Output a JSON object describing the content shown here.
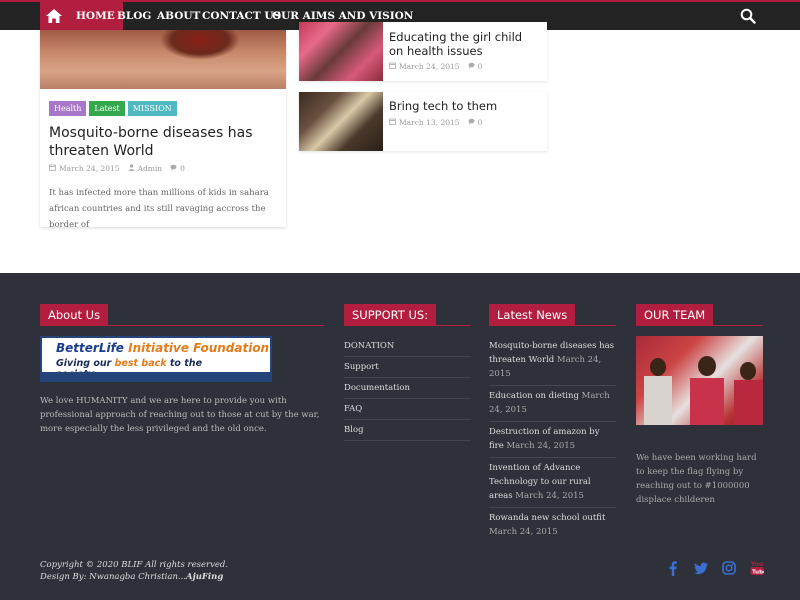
{
  "nav": {
    "items": [
      {
        "label": "HOME",
        "active": true
      },
      {
        "label": "BLOG"
      },
      {
        "label": "ABOUT"
      },
      {
        "label": "CONTACT US"
      },
      {
        "label": "OUR AIMS AND VISION"
      }
    ],
    "home_icon": "home-icon",
    "search_icon": "search-icon"
  },
  "featured": {
    "tags": [
      {
        "label": "Health",
        "color": "#a877c8"
      },
      {
        "label": "Latest",
        "color": "#35a84d"
      },
      {
        "label": "MISSION",
        "color": "#4fb8c0"
      }
    ],
    "title": "Mosquito-borne diseases has threaten World",
    "date": "March 24, 2015",
    "author": "Admin",
    "comments": "0",
    "excerpt": "It has infected more than millions of kids in sahara african countries and its still ravaging accross the border of"
  },
  "side_posts": [
    {
      "title": "Educating the girl child on health issues",
      "date": "March 24, 2015",
      "comments": "0"
    },
    {
      "title": "Bring tech to them",
      "date": "March 13, 2015",
      "comments": "0"
    }
  ],
  "footer": {
    "about": {
      "title": "About Us",
      "logo_line1a": "BetterLife ",
      "logo_line1b": "Initiative Foundation",
      "logo_line2a": "Giving our ",
      "logo_line2b": "best back",
      "logo_line2c": " to the society............",
      "text": "We love HUMANITY and we are here to provide you with professional approach of reaching out to those at cut by the war, more especially the less privileged and the old once."
    },
    "support": {
      "title": "SUPPORT US:",
      "items": [
        "DONATION",
        "Support",
        "Documentation",
        "FAQ",
        "Blog"
      ]
    },
    "news": {
      "title": "Latest News",
      "items": [
        {
          "title": "Mosquito-borne diseases has threaten World",
          "date": "March 24, 2015"
        },
        {
          "title": "Education on dieting",
          "date": "March 24, 2015"
        },
        {
          "title": "Destruction of amazon by fire",
          "date": "March 24, 2015"
        },
        {
          "title": "Invention of Advance Technology to our rural areas",
          "date": "March 24, 2015"
        },
        {
          "title": "Rowanda new school outfit",
          "date": "March 24, 2015"
        }
      ]
    },
    "team": {
      "title": "OUR TEAM",
      "text": "We have been working hard to keep the flag flying by reaching out to #1000000 displace childeren"
    },
    "copyright_line1": "Copyright © 2020 BLIF All rights reserved.",
    "copyright_line2_prefix": "Design By: Nwanagba Christian...",
    "copyright_line2_author": "AjuFing",
    "social": [
      "facebook-icon",
      "twitter-icon",
      "instagram-icon",
      "youtube-icon"
    ],
    "social_color": "#3b6fd1"
  },
  "colors": {
    "accent": "#b21e3f",
    "nav_bg": "#232323",
    "footer_bg": "#2f313a"
  }
}
